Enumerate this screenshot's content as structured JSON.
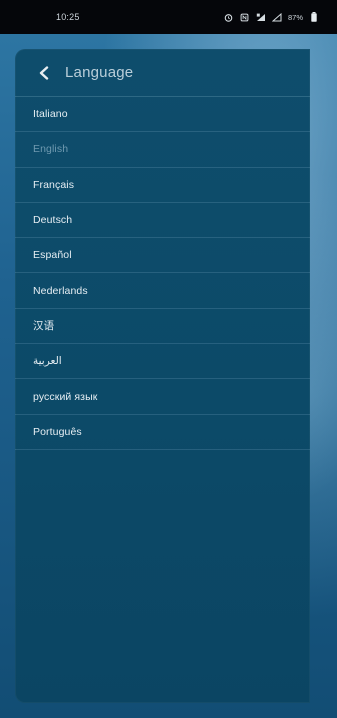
{
  "status_bar": {
    "time": "10:25",
    "battery": "87%",
    "icons": [
      "alarm-icon",
      "nfc-icon",
      "signal-icon",
      "wifi-signal-icon",
      "battery-icon"
    ]
  },
  "header": {
    "title": "Language",
    "back_icon": "chevron-left-icon"
  },
  "languages": [
    {
      "label": "Italiano",
      "selected": false
    },
    {
      "label": "English",
      "selected": true
    },
    {
      "label": "Français",
      "selected": false
    },
    {
      "label": "Deutsch",
      "selected": false
    },
    {
      "label": "Español",
      "selected": false
    },
    {
      "label": "Nederlands",
      "selected": false
    },
    {
      "label": "汉语",
      "selected": false
    },
    {
      "label": "العربية",
      "selected": false
    },
    {
      "label": "русский язык",
      "selected": false
    },
    {
      "label": "Português",
      "selected": false
    }
  ],
  "colors": {
    "drawer_bg": "#0e4d6c",
    "item_text": "#e6eef3",
    "selected_text": "#6f99b0",
    "title_text": "#b9ced9",
    "status_bar_bg": "#05060a"
  }
}
